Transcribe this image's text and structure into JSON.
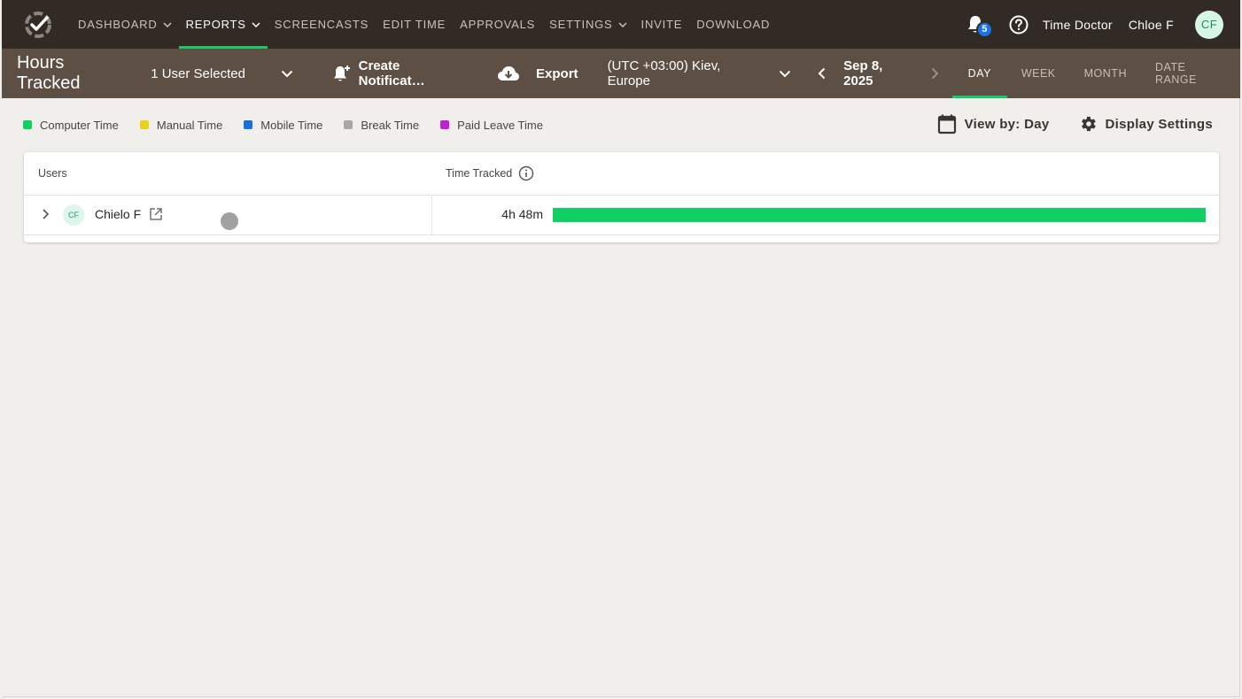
{
  "nav": {
    "items": [
      {
        "label": "DASHBOARD",
        "dropdown": true,
        "active": false
      },
      {
        "label": "REPORTS",
        "dropdown": true,
        "active": true
      },
      {
        "label": "SCREENCASTS",
        "dropdown": false,
        "active": false
      },
      {
        "label": "EDIT TIME",
        "dropdown": false,
        "active": false
      },
      {
        "label": "APPROVALS",
        "dropdown": false,
        "active": false
      },
      {
        "label": "SETTINGS",
        "dropdown": true,
        "active": false
      },
      {
        "label": "INVITE",
        "dropdown": false,
        "active": false
      },
      {
        "label": "DOWNLOAD",
        "dropdown": false,
        "active": false
      }
    ],
    "notification_count": "5",
    "company": "Time Doctor",
    "username": "Chloe F",
    "avatar_initials": "CF"
  },
  "toolbar": {
    "title": "Hours Tracked",
    "user_select": "1 User Selected",
    "create_notification": "Create Notificat…",
    "export": "Export",
    "timezone": "(UTC +03:00) Kiev, Europe",
    "date": "Sep 8, 2025",
    "range_tabs": [
      {
        "label": "DAY",
        "active": true
      },
      {
        "label": "WEEK",
        "active": false
      },
      {
        "label": "MONTH",
        "active": false
      },
      {
        "label": "DATE RANGE",
        "active": false
      }
    ]
  },
  "legend": [
    {
      "label": "Computer Time",
      "color": "#10d064"
    },
    {
      "label": "Manual Time",
      "color": "#e8d21f"
    },
    {
      "label": "Mobile Time",
      "color": "#1a6fe0"
    },
    {
      "label": "Break Time",
      "color": "#a9a7a4"
    },
    {
      "label": "Paid Leave Time",
      "color": "#c41ed6"
    }
  ],
  "view_controls": {
    "view_by": "View by: Day",
    "display_settings": "Display Settings"
  },
  "table": {
    "headers": {
      "users": "Users",
      "time_tracked": "Time Tracked"
    },
    "rows": [
      {
        "initials": "CF",
        "name": "Chielo F",
        "time": "4h 48m",
        "computer_time_fraction": 1.0
      }
    ]
  },
  "colors": {
    "topbar": "#322a24",
    "subbar": "#5e4f45",
    "accent": "#19c869",
    "background": "#f0efec"
  }
}
